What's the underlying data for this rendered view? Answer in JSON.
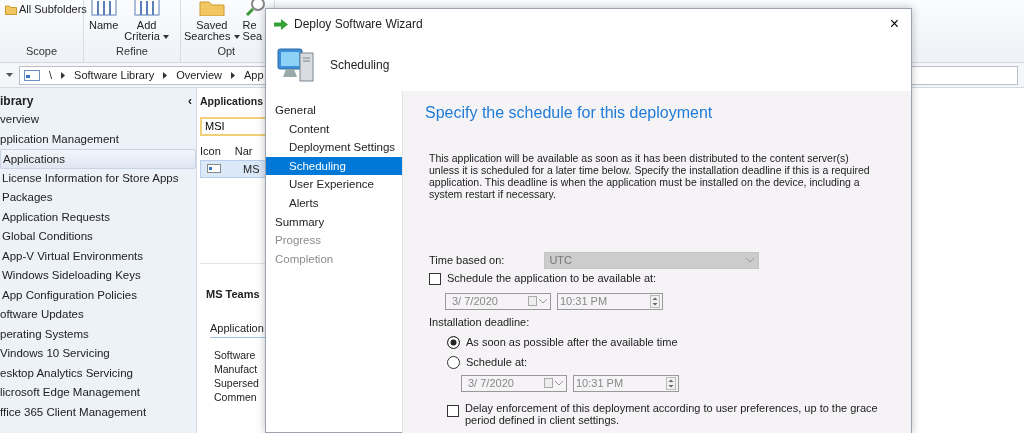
{
  "ribbon": {
    "groups": [
      {
        "label": "Scope",
        "buttons": [
          {
            "lines": [
              "All Subfolders"
            ],
            "dropdown": false
          }
        ]
      },
      {
        "label": "Refine",
        "buttons": [
          {
            "lines": [
              "Name"
            ],
            "dropdown": false
          },
          {
            "lines": [
              "Add",
              "Criteria"
            ],
            "dropdown": true
          }
        ]
      },
      {
        "label": "Opt",
        "buttons": [
          {
            "lines": [
              "Saved",
              "Searches"
            ],
            "dropdown": true
          },
          {
            "lines": [
              "Re",
              "Sea"
            ],
            "dropdown": false
          }
        ]
      }
    ]
  },
  "breadcrumb": [
    "\\",
    "Software Library",
    "Overview",
    "App"
  ],
  "navigation": {
    "title": "ibrary",
    "collapse": "‹",
    "items": [
      {
        "label": "verview",
        "selected": false
      },
      {
        "label": "pplication Management",
        "selected": false,
        "children": [
          {
            "label": "Applications",
            "selected": true
          },
          {
            "label": "License Information for Store Apps",
            "selected": false
          },
          {
            "label": "Packages",
            "selected": false
          },
          {
            "label": "Application Requests",
            "selected": false
          },
          {
            "label": "Global Conditions",
            "selected": false
          },
          {
            "label": "App-V Virtual Environments",
            "selected": false
          },
          {
            "label": "Windows Sideloading Keys",
            "selected": false
          },
          {
            "label": "App Configuration Policies",
            "selected": false
          }
        ]
      },
      {
        "label": "oftware Updates",
        "selected": false
      },
      {
        "label": "perating Systems",
        "selected": false
      },
      {
        "label": "Vindows 10 Servicing",
        "selected": false
      },
      {
        "label": "esktop Analytics Servicing",
        "selected": false
      },
      {
        "label": "licrosoft Edge Management",
        "selected": false
      },
      {
        "label": "ffice 365 Client Management",
        "selected": false
      }
    ]
  },
  "list_pane": {
    "title": "Applications",
    "search": "MSI",
    "columns": [
      "Icon",
      "Nar"
    ],
    "rows": [
      {
        "name": "MS"
      }
    ]
  },
  "details": {
    "title": "MS Teams",
    "tab": "Application",
    "fields": [
      "Software",
      "Manufact",
      "Supersed",
      "Commen"
    ]
  },
  "dialog": {
    "title": "Deploy Software Wizard",
    "close": "×",
    "page_title": "Scheduling",
    "steps": [
      {
        "label": "General",
        "selected": false,
        "disabled": false,
        "children": [
          {
            "label": "Content",
            "selected": false,
            "disabled": false
          },
          {
            "label": "Deployment Settings",
            "selected": false,
            "disabled": false
          },
          {
            "label": "Scheduling",
            "selected": true,
            "disabled": false
          },
          {
            "label": "User Experience",
            "selected": false,
            "disabled": false
          },
          {
            "label": "Alerts",
            "selected": false,
            "disabled": false
          }
        ]
      },
      {
        "label": "Summary",
        "selected": false,
        "disabled": false
      },
      {
        "label": "Progress",
        "selected": false,
        "disabled": true
      },
      {
        "label": "Completion",
        "selected": false,
        "disabled": true
      }
    ],
    "heading": "Specify the schedule for this deployment",
    "description": "This application will be available as soon as it has been distributed to the content server(s) unless it is scheduled for a later time below. Specify the installation deadline if this is a required application. This deadline is when the application must be installed on the device, including a system restart if necessary.",
    "time_based": {
      "label": "Time based on:",
      "value": "UTC",
      "disabled": true
    },
    "schedule_available": {
      "label": "Schedule the application to be available at:",
      "checked": false,
      "date": "3/ 7/2020",
      "time": "10:31 PM",
      "disabled": true
    },
    "deadline": {
      "label": "Installation deadline:",
      "options": [
        {
          "label": "As soon as possible after the available time",
          "selected": true
        },
        {
          "label": "Schedule at:",
          "selected": false
        }
      ],
      "date": "3/ 7/2020",
      "time": "10:31 PM",
      "disabled": true
    },
    "delay": {
      "label": "Delay enforcement of this deployment according to user preferences, up to the grace period defined in client settings.",
      "checked": false
    }
  }
}
